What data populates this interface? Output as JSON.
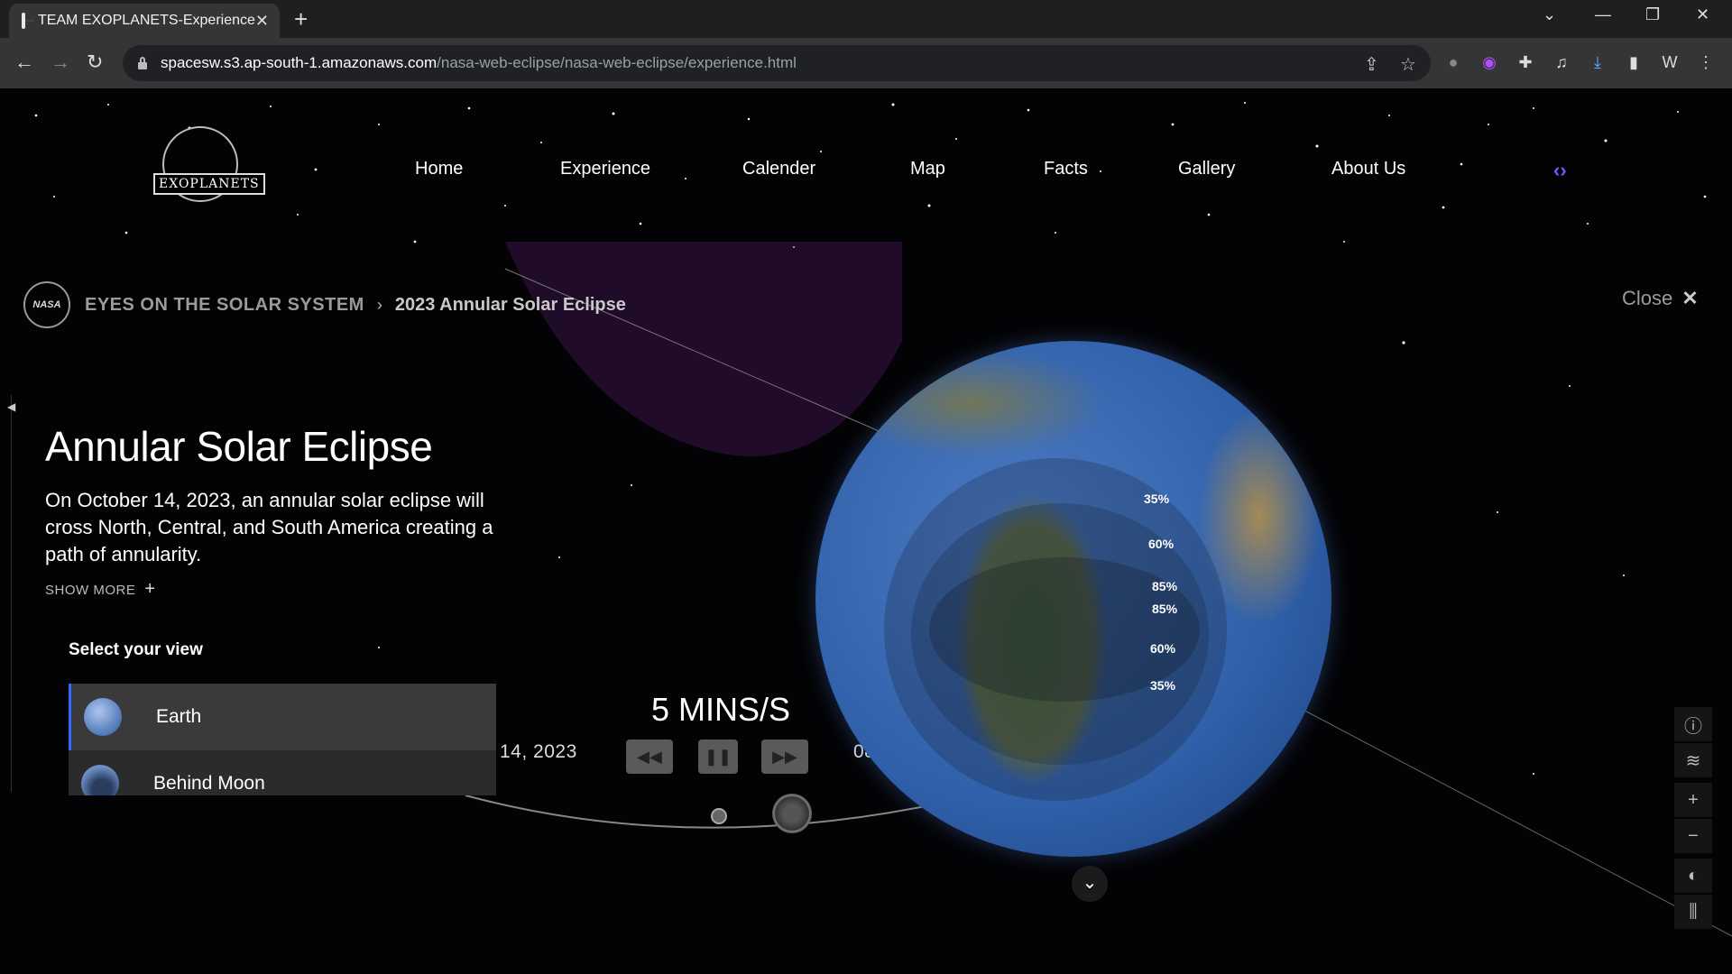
{
  "browser": {
    "tab_title": "TEAM EXOPLANETS-Experience",
    "url_host": "spacesw.s3.ap-south-1.amazonaws.com",
    "url_path": "/nasa-web-eclipse/nasa-web-eclipse/experience.html"
  },
  "site": {
    "logo_text": "EXOPLANETS",
    "nav": [
      "Home",
      "Experience",
      "Calender",
      "Map",
      "Facts",
      "Gallery",
      "About Us"
    ]
  },
  "header": {
    "brand": "NASA",
    "crumb_root": "EYES ON THE SOLAR SYSTEM",
    "crumb_current": "2023 Annular Solar Eclipse",
    "close_label": "Close"
  },
  "panel": {
    "title": "Annular Solar Eclipse",
    "description": "On October 14, 2023, an annular solar eclipse will cross North, Central, and South America creating a path of annularity.",
    "show_more": "SHOW MORE",
    "view_heading": "Select your view",
    "views": [
      {
        "name": "Earth",
        "active": true
      },
      {
        "name": "Behind Moon",
        "active": false
      }
    ]
  },
  "time": {
    "rate": "5 MINS/S",
    "date": "14, 2023",
    "clock": "08:25:05PM"
  },
  "globe": {
    "labels": [
      "35%",
      "60%",
      "85%",
      "85%",
      "60%",
      "35%"
    ]
  },
  "tools": [
    "info-icon",
    "layers-icon",
    "zoom-in-icon",
    "zoom-out-icon",
    "lighting-icon",
    "settings-sliders-icon"
  ],
  "colors": {
    "active_accent": "#2d6cff",
    "code_icon": "#6b5cff",
    "chrome_bg": "#353535"
  }
}
